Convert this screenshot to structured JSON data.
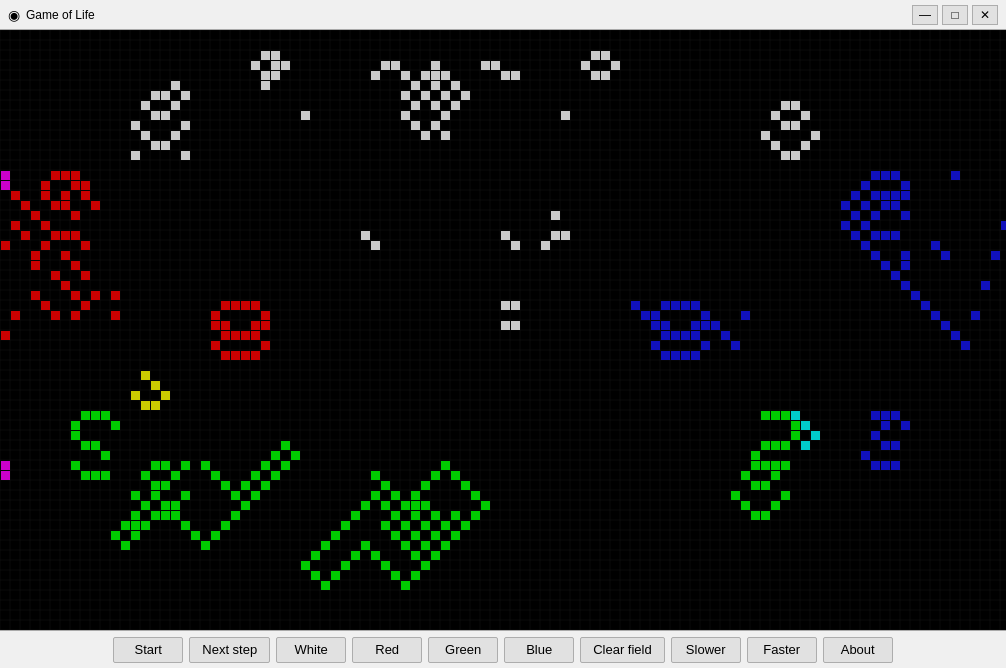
{
  "window": {
    "title": "Game of Life",
    "title_icon": "◉"
  },
  "title_controls": {
    "minimize": "—",
    "maximize": "□",
    "close": "✕"
  },
  "toolbar": {
    "buttons": [
      {
        "id": "start",
        "label": "Start"
      },
      {
        "id": "next-step",
        "label": "Next step"
      },
      {
        "id": "white",
        "label": "White"
      },
      {
        "id": "red",
        "label": "Red"
      },
      {
        "id": "green",
        "label": "Green"
      },
      {
        "id": "blue",
        "label": "Blue"
      },
      {
        "id": "clear-field",
        "label": "Clear field"
      },
      {
        "id": "slower",
        "label": "Slower"
      },
      {
        "id": "faster",
        "label": "Faster"
      },
      {
        "id": "about",
        "label": "About"
      }
    ]
  },
  "colors": {
    "background": "#000000",
    "white_cell": "#d0d0d0",
    "red_cell": "#cc0000",
    "green_cell": "#00cc00",
    "blue_cell": "#0000bb",
    "yellow_cell": "#cccc00",
    "cyan_cell": "#00cccc",
    "magenta_cell": "#cc00cc"
  }
}
